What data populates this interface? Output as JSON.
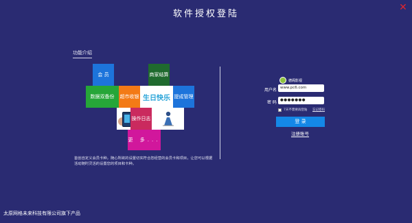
{
  "window": {
    "title": "软件授权登陆"
  },
  "features": {
    "title": "功能介绍",
    "tiles": {
      "member": "会 员",
      "merchant": "商家结算",
      "backup": "数据双备份",
      "market": "超市收银",
      "birthday": "生日快乐",
      "reminder": "提成管理",
      "log": "操作日志",
      "more": "更 多..."
    },
    "description": "首创自定义会员卡种，随心所欲的设置切实符合您经营的会员卡和项目，让您可以根据活动随时灵活的设置您的项目和卡种。"
  },
  "login": {
    "logo_text": "德阁影视",
    "username_label": "用户名",
    "username_value": "www.pc6.com",
    "password_label": "密 码",
    "password_value": "●●●●●●●",
    "remember_label": "7天不需要再登陆",
    "forgot_label": "忘记密码",
    "login_button": "登 录",
    "register_link": "注册账号"
  },
  "footer": {
    "text": "太原网格未来科技有限公司旗下产品"
  },
  "colors": {
    "background": "#2a2b72",
    "close": "#e0262d",
    "login_button": "#1488e7"
  },
  "icons": {
    "close": "close-icon",
    "logo": "logo-icon",
    "phone": "phone-icon",
    "person": "person-icon"
  }
}
